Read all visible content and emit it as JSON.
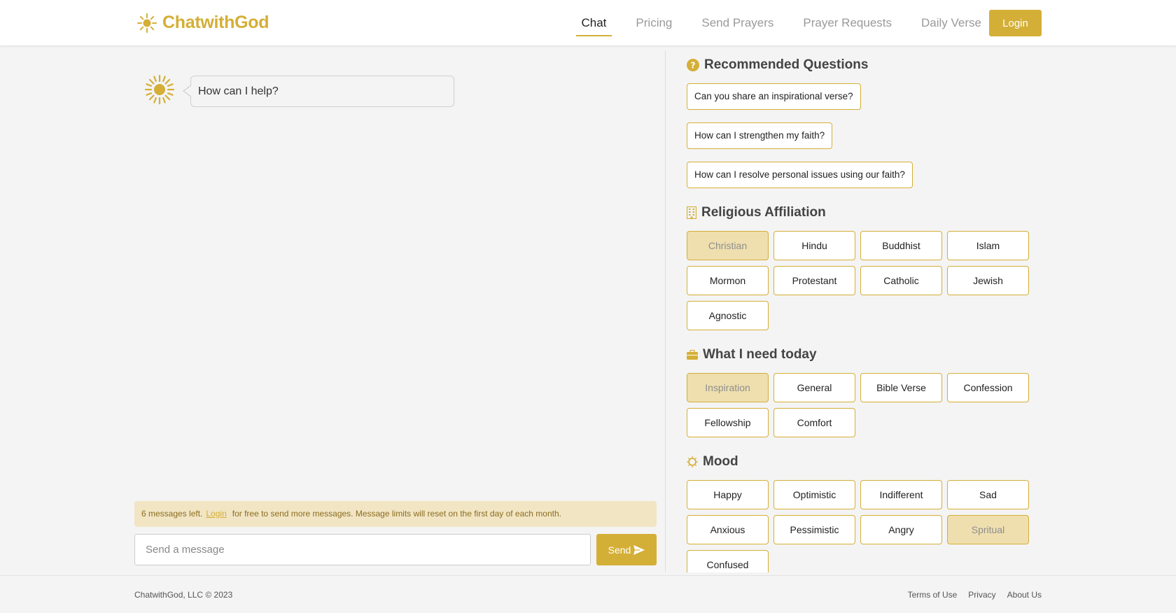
{
  "brand": {
    "name": "ChatwithGod",
    "accent_color": "#d4af37",
    "icon": "sun-icon"
  },
  "nav": {
    "items": [
      {
        "label": "Chat",
        "active": true
      },
      {
        "label": "Pricing",
        "active": false
      },
      {
        "label": "Send Prayers",
        "active": false
      },
      {
        "label": "Prayer Requests",
        "active": false
      },
      {
        "label": "Daily Verse",
        "active": false
      }
    ],
    "login_label": "Login"
  },
  "chat": {
    "greeting": "How can I help?",
    "limit_notice": {
      "prefix": "6 messages left.",
      "link": "Login",
      "suffix": "for free to send more messages. Message limits will reset on the first day of each month."
    },
    "input_placeholder": "Send a message",
    "send_label": "Send"
  },
  "sidebar": {
    "recommended": {
      "title": "Recommended Questions",
      "icon": "question-circle-icon",
      "items": [
        "Can you share an inspirational verse?",
        "How can I strengthen my faith?",
        "How can I resolve personal issues using our faith?"
      ]
    },
    "religion": {
      "title": "Religious Affiliation",
      "icon": "building-icon",
      "items": [
        "Christian",
        "Hindu",
        "Buddhist",
        "Islam",
        "Mormon",
        "Protestant",
        "Catholic",
        "Jewish",
        "Agnostic"
      ],
      "selected": "Christian"
    },
    "need": {
      "title": "What I need today",
      "icon": "briefcase-icon",
      "items": [
        "Inspiration",
        "General",
        "Bible Verse",
        "Confession",
        "Fellowship",
        "Comfort"
      ],
      "selected": "Inspiration"
    },
    "mood": {
      "title": "Mood",
      "icon": "sun-outline-icon",
      "items": [
        "Happy",
        "Optimistic",
        "Indifferent",
        "Sad",
        "Anxious",
        "Pessimistic",
        "Angry",
        "Spritual",
        "Confused"
      ],
      "selected": "Spritual"
    }
  },
  "footer": {
    "copyright": "ChatwithGod, LLC © 2023",
    "links": [
      "Terms of Use",
      "Privacy",
      "About Us"
    ]
  }
}
